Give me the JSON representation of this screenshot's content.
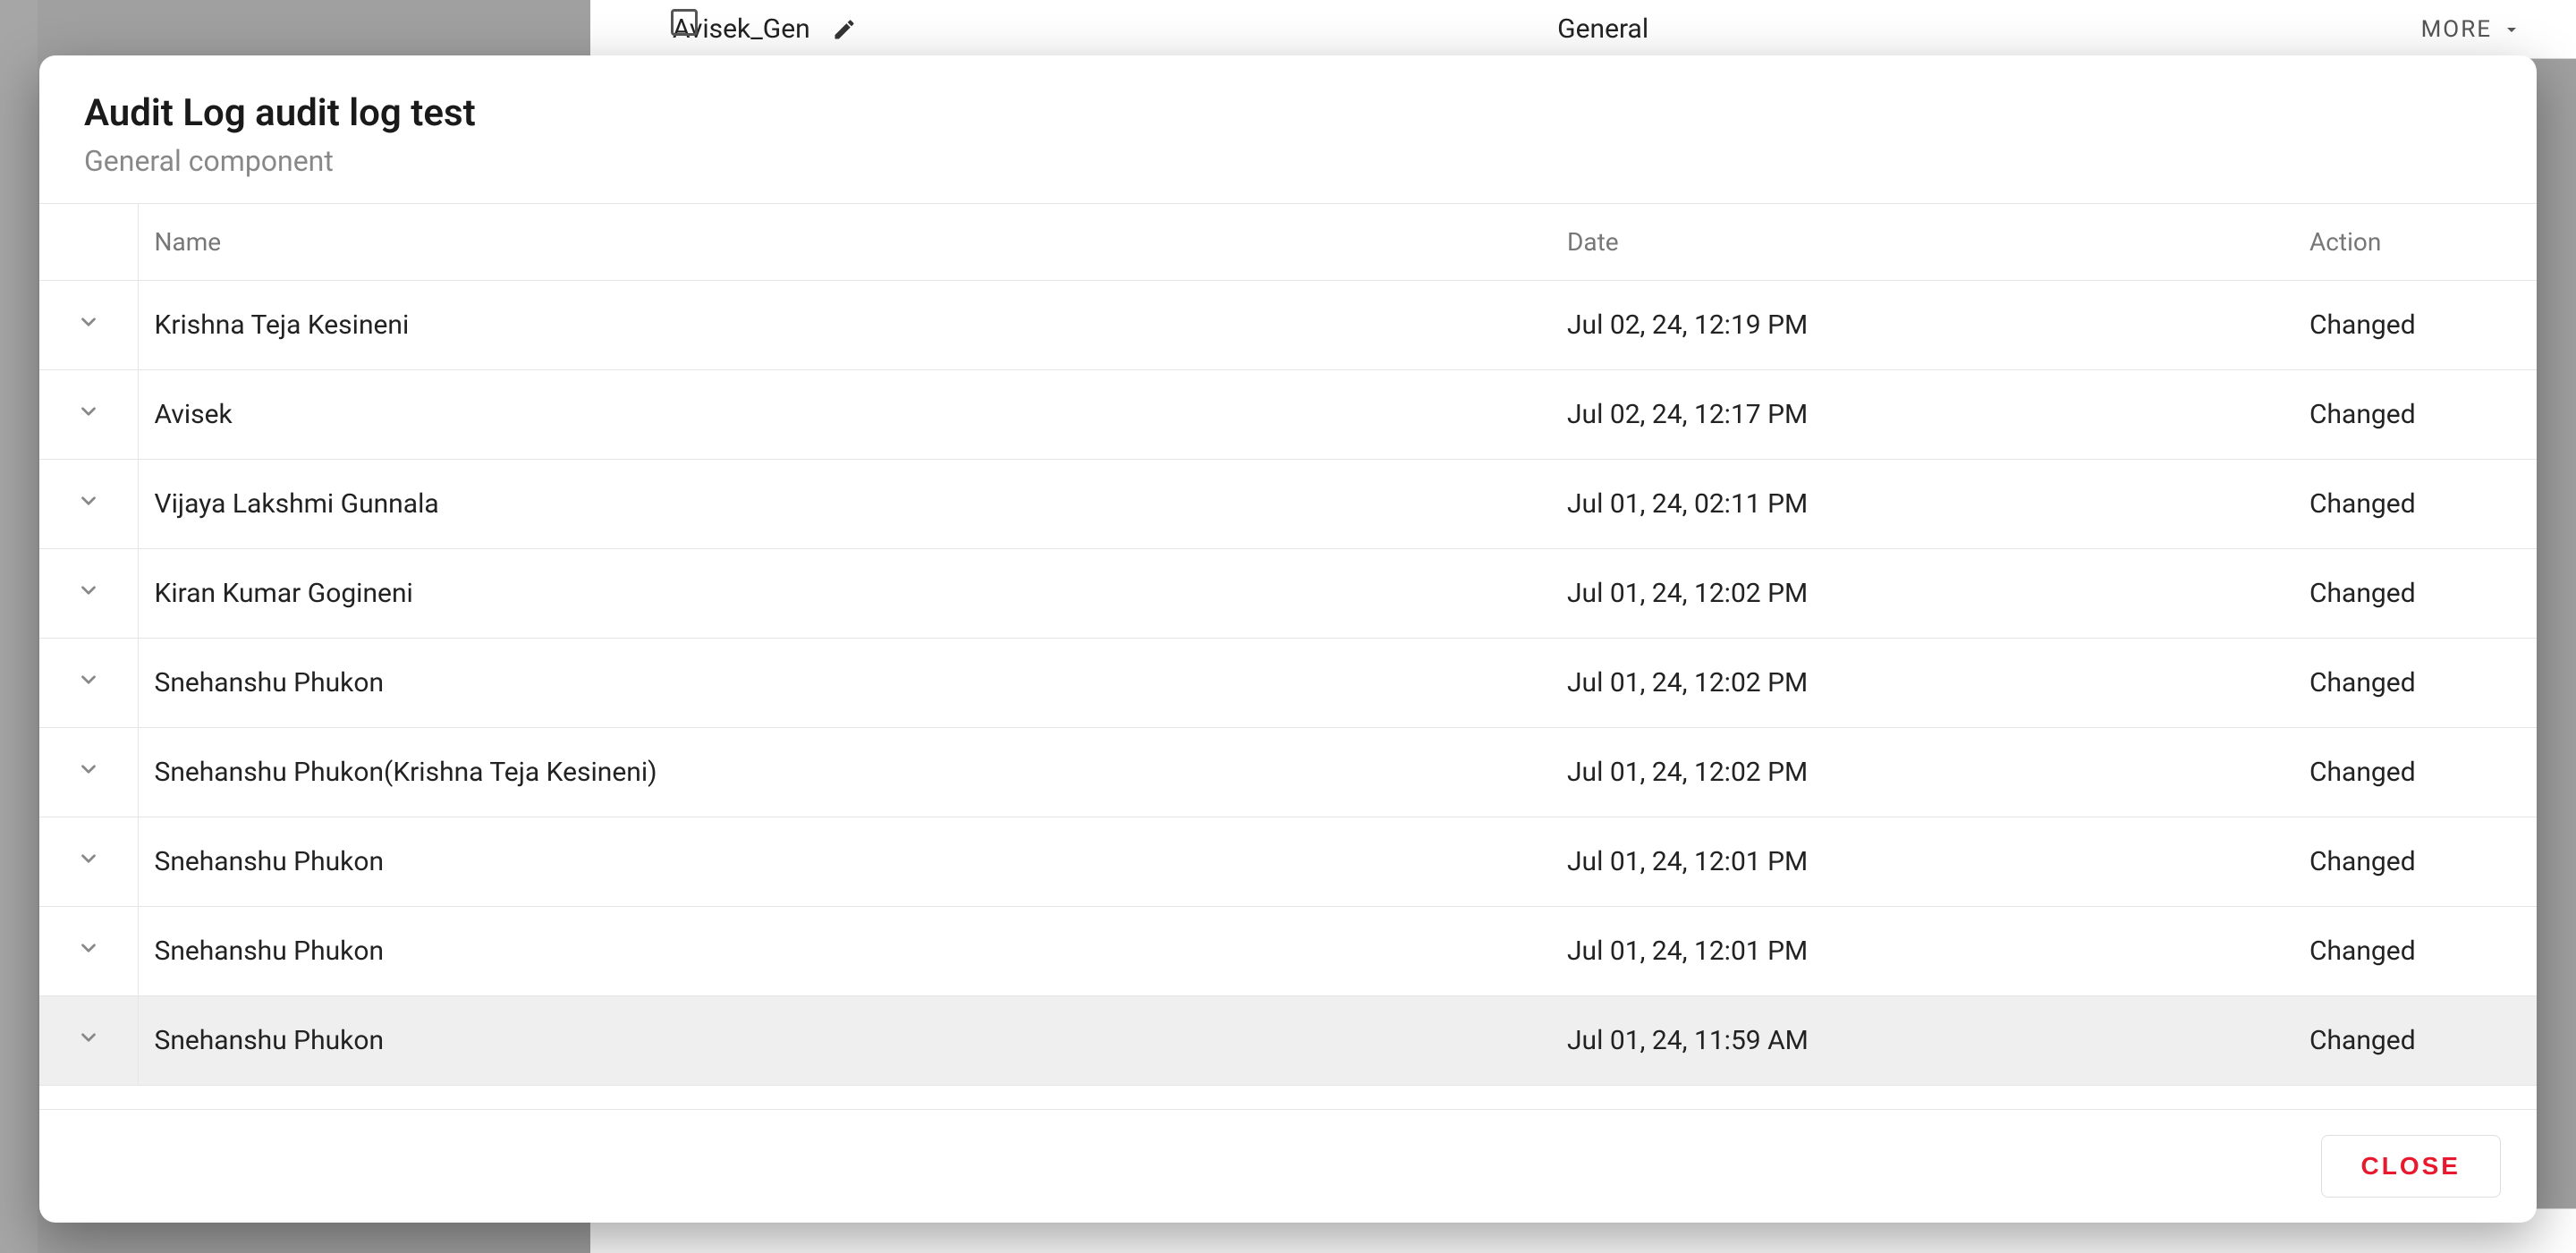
{
  "background": {
    "item_name": "Avisek_Gen",
    "item_type": "General",
    "more_label": "MORE"
  },
  "modal": {
    "title": "Audit Log audit log test",
    "subtitle": "General component",
    "close_label": "CLOSE"
  },
  "columns": {
    "name": "Name",
    "date": "Date",
    "action": "Action"
  },
  "rows": [
    {
      "name": "Krishna Teja Kesineni",
      "date": "Jul 02, 24, 12:19 PM",
      "action": "Changed",
      "hovered": false
    },
    {
      "name": "Avisek",
      "date": "Jul 02, 24, 12:17 PM",
      "action": "Changed",
      "hovered": false
    },
    {
      "name": "Vijaya Lakshmi Gunnala",
      "date": "Jul 01, 24, 02:11 PM",
      "action": "Changed",
      "hovered": false
    },
    {
      "name": "Kiran Kumar Gogineni",
      "date": "Jul 01, 24, 12:02 PM",
      "action": "Changed",
      "hovered": false
    },
    {
      "name": "Snehanshu Phukon",
      "date": "Jul 01, 24, 12:02 PM",
      "action": "Changed",
      "hovered": false
    },
    {
      "name": "Snehanshu Phukon(Krishna Teja Kesineni)",
      "date": "Jul 01, 24, 12:02 PM",
      "action": "Changed",
      "hovered": false
    },
    {
      "name": "Snehanshu Phukon",
      "date": "Jul 01, 24, 12:01 PM",
      "action": "Changed",
      "hovered": false
    },
    {
      "name": "Snehanshu Phukon",
      "date": "Jul 01, 24, 12:01 PM",
      "action": "Changed",
      "hovered": false
    },
    {
      "name": "Snehanshu Phukon",
      "date": "Jul 01, 24, 11:59 AM",
      "action": "Changed",
      "hovered": true
    }
  ]
}
